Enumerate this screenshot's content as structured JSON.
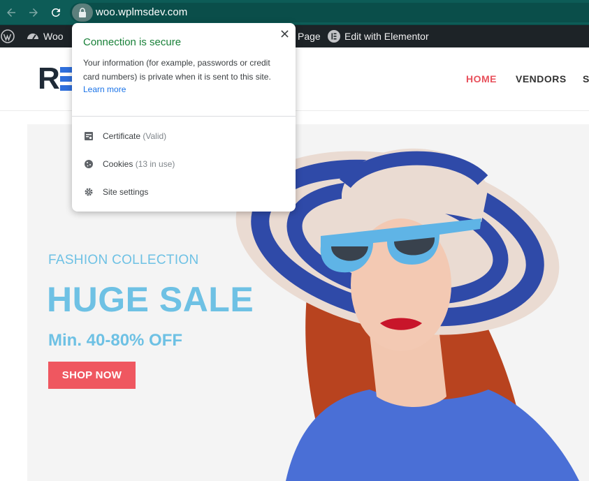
{
  "browser": {
    "url": "woo.wplmsdev.com",
    "icons": {
      "back": "arrow-left-icon",
      "forward": "arrow-right-icon",
      "reload": "reload-icon",
      "lock": "lock-icon"
    }
  },
  "admin_bar": {
    "site_label": "Woo",
    "page_label": "Page",
    "elementor_label": "Edit with Elementor"
  },
  "site": {
    "nav": {
      "home": "HOME",
      "vendors": "VENDORS",
      "partial": "S"
    }
  },
  "hero": {
    "eyebrow": "FASHION COLLECTION",
    "title": "HUGE SALE",
    "subtitle": "Min. 40-80% OFF",
    "cta": "SHOP NOW"
  },
  "popup": {
    "title": "Connection is secure",
    "description": "Your information (for example, passwords or credit card numbers) is private when it is sent to this site.",
    "learn_more": "Learn more",
    "certificate_label": "Certificate",
    "certificate_status": "(Valid)",
    "cookies_label": "Cookies",
    "cookies_status": "(13 in use)",
    "site_settings_label": "Site settings"
  },
  "colors": {
    "chrome": "#0d5c57",
    "admin_bar": "#1d2327",
    "secure_green": "#188038",
    "link_blue": "#1a73e8",
    "hero_blue": "#6ec1e4",
    "cta_red": "#ef5760",
    "nav_active": "#e8505b"
  }
}
